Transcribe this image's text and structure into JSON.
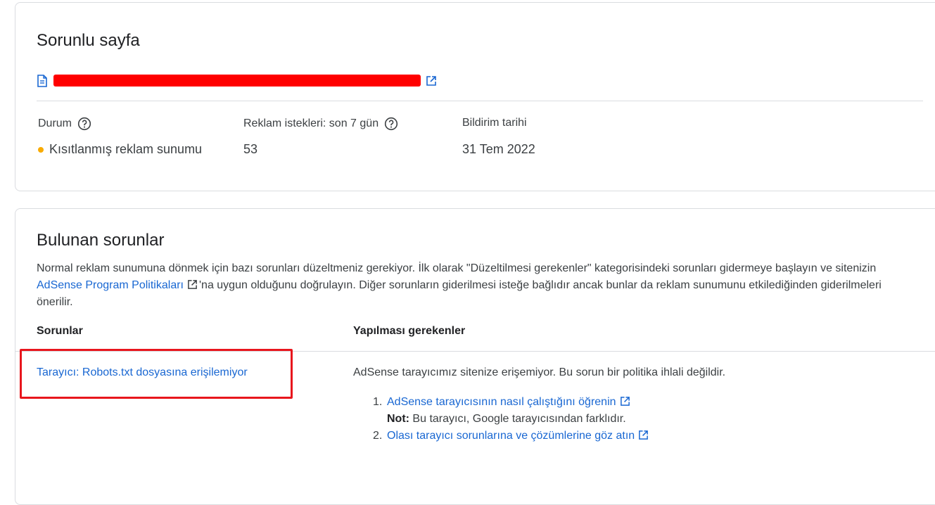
{
  "page_card": {
    "title": "Sorunlu sayfa",
    "url_redacted": "",
    "status": {
      "label": "Durum",
      "value": "Kısıtlanmış reklam sunumu",
      "dot_color": "#f9ab00"
    },
    "ad_requests": {
      "label": "Reklam istekleri: son 7 gün",
      "value": "53"
    },
    "notice_date": {
      "label": "Bildirim tarihi",
      "value": "31 Tem 2022"
    }
  },
  "issues_card": {
    "title": "Bulunan sorunlar",
    "description_part1": "Normal reklam sunumuna dönmek için bazı sorunları düzeltmeniz gerekiyor. İlk olarak \"Düzeltilmesi gerekenler\" kategorisindeki sorunları gidermeye başlayın ve sitenizin ",
    "policy_link": "AdSense Program Politikaları",
    "description_part2": "'na uygun olduğunu doğrulayın. Diğer sorunların giderilmesi isteğe bağlıdır ancak bunlar da reklam sunumunu etkilediğinden giderilmeleri önerilir.",
    "columns": [
      "Sorunlar",
      "Yapılması gerekenler"
    ],
    "issue": {
      "name": "Tarayıcı: Robots.txt dosyasına erişilemiyor",
      "action_text": "AdSense tarayıcımız sitenize erişemiyor. Bu sorun bir politika ihlali değildir.",
      "steps": [
        {
          "num": "1.",
          "link": "AdSense tarayıcısının nasıl çalıştığını öğrenin"
        },
        {
          "num": "2.",
          "link": "Olası tarayıcı sorunlarına ve çözümlerine göz atın"
        }
      ],
      "note_label": "Not:",
      "note_text": " Bu tarayıcı, Google tarayıcısından farklıdır."
    },
    "highlight_color": "#e8161d"
  },
  "colors": {
    "link": "#1967d2",
    "border": "#dadce0",
    "text": "#3c4043"
  }
}
